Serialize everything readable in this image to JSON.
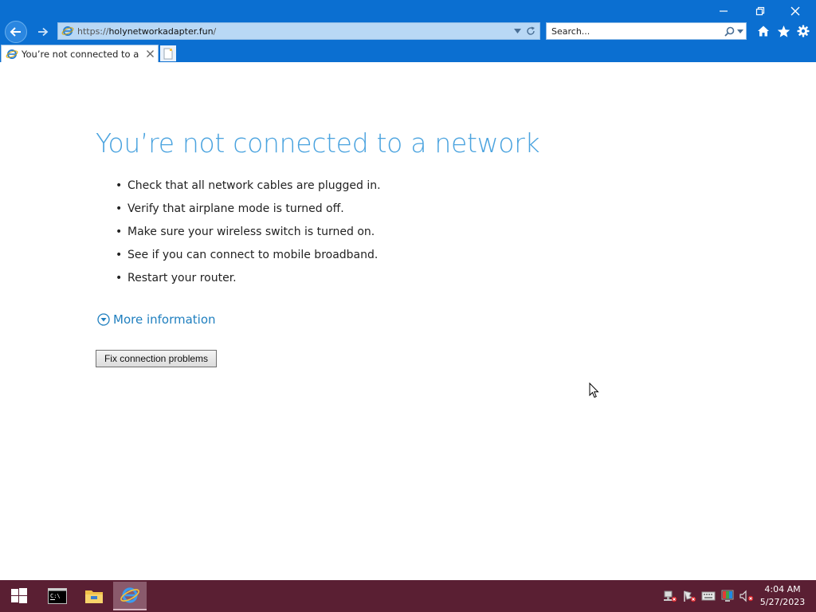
{
  "browser": {
    "address": {
      "protocol": "https://",
      "host": "holynetworkadapter.fun",
      "path": "/"
    },
    "search": {
      "placeholder": "Search..."
    },
    "tab": {
      "title": "You’re not connected to a n..."
    }
  },
  "page": {
    "title": "You’re not connected to a network",
    "tips": [
      "Check that all network cables are plugged in.",
      "Verify that airplane mode is turned off.",
      "Make sure your wireless switch is turned on.",
      "See if you can connect to mobile broadband.",
      "Restart your router."
    ],
    "more_info_label": "More information",
    "fix_button_label": "Fix connection problems"
  },
  "taskbar": {
    "time": "4:04 AM",
    "date": "5/27/2023"
  },
  "colors": {
    "chrome": "#0b6fd1",
    "title": "#4aa3df",
    "link": "#1f7fbf",
    "taskbar": "#5a1f33"
  }
}
